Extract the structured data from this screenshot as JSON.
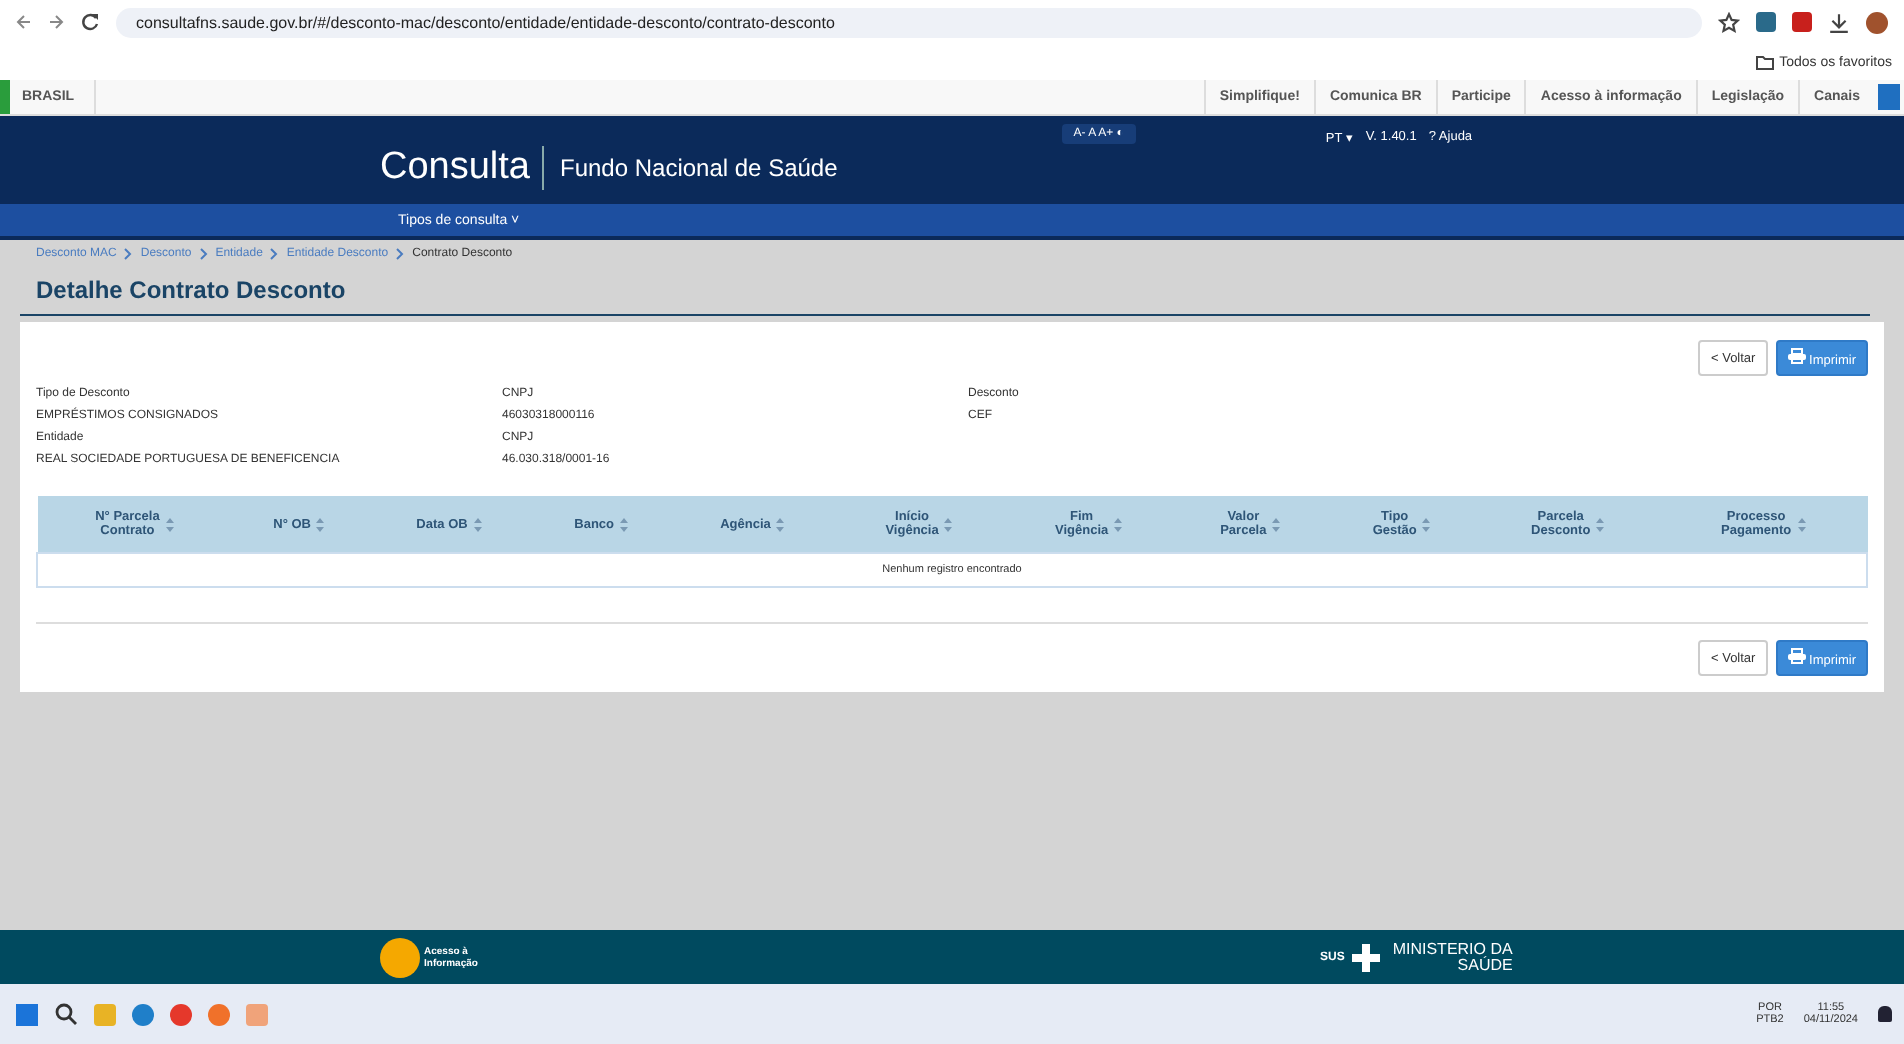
{
  "browser": {
    "url": "consultafns.saude.gov.br/#/desconto-mac/desconto/entidade/entidade-desconto/contrato-desconto",
    "bookmarks_folder": "Todos os favoritos"
  },
  "gov_bar": {
    "brand": "BRASIL",
    "links": [
      "Simplifique!",
      "Comunica BR",
      "Participe",
      "Acesso à informação",
      "Legislação",
      "Canais"
    ]
  },
  "header": {
    "title": "Consulta",
    "subtitle": "Fundo Nacional de Saúde",
    "font_controls": "A- A A+ ◐",
    "language": "PT ▾",
    "version": "V. 1.40.1",
    "help": "? Ajuda"
  },
  "nav": {
    "menu": "Tipos de consulta ˅"
  },
  "breadcrumb": [
    {
      "label": "Desconto MAC",
      "link": true
    },
    {
      "label": "Desconto",
      "link": true
    },
    {
      "label": "Entidade",
      "link": true
    },
    {
      "label": "Entidade Desconto",
      "link": true
    },
    {
      "label": "Contrato Desconto",
      "link": false
    }
  ],
  "page_title": "Detalhe Contrato Desconto",
  "button_rows": [
    {
      "back": "< Voltar",
      "print": "Imprimir"
    },
    {
      "back": "< Voltar",
      "print": "Imprimir"
    }
  ],
  "fields": [
    {
      "label": "Tipo de Desconto",
      "value": "EMPRÉSTIMOS CONSIGNADOS"
    },
    {
      "label": "CNPJ",
      "value": "46030318000116"
    },
    {
      "label": "Desconto",
      "value": "CEF"
    },
    {
      "label": "Entidade",
      "value": "REAL SOCIEDADE PORTUGUESA DE BENEFICENCIA"
    },
    {
      "label": "CNPJ",
      "value": "46.030.318/0001-16"
    }
  ],
  "table": {
    "columns": [
      {
        "line1": "N° Parcela",
        "line2": "Contrato"
      },
      {
        "line1": "N° OB"
      },
      {
        "line1": "Data OB"
      },
      {
        "line1": "Banco"
      },
      {
        "line1": "Agência"
      },
      {
        "line1": "Início",
        "line2": "Vigência"
      },
      {
        "line1": "Fim",
        "line2": "Vigência"
      },
      {
        "line1": "Valor",
        "line2": "Parcela"
      },
      {
        "line1": "Tipo",
        "line2": "Gestão"
      },
      {
        "line1": "Parcela",
        "line2": "Desconto"
      },
      {
        "line1": "Processo",
        "line2": "Pagamento"
      }
    ],
    "empty_message": "Nenhum registro encontrado"
  },
  "footer": {
    "access_info": "Acesso à Informação",
    "sus": "SUS",
    "ministry": "MINISTERIO DA SAÚDE"
  },
  "taskbar": {
    "language": "POR",
    "layout": "PTB2",
    "time": "11:55",
    "date": "04/11/2024"
  }
}
